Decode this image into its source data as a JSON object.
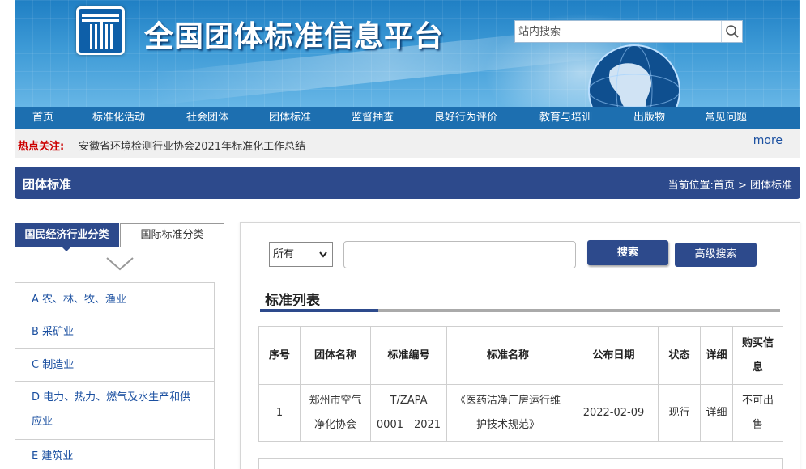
{
  "header": {
    "site_title": "全国团体标准信息平台",
    "search_placeholder": "站内搜索"
  },
  "nav": {
    "items": [
      "首页",
      "标准化活动",
      "社会团体",
      "团体标准",
      "监督抽查",
      "良好行为评价",
      "教育与培训",
      "出版物",
      "常见问题"
    ]
  },
  "hotbar": {
    "label": "热点关注:",
    "text": "安徽省环境检测行业协会2021年标准化工作总结",
    "more": "more"
  },
  "section": {
    "title": "团体标准",
    "breadcrumb": "当前位置:首页 > 团体标准"
  },
  "left": {
    "tab_active": "国民经济行业分类",
    "tab_other": "国际标准分类",
    "categories": [
      "A 农、林、牧、渔业",
      "B 采矿业",
      "C 制造业",
      "D 电力、热力、燃气及水生产和供应业",
      "E 建筑业"
    ]
  },
  "search": {
    "select_value": "所有",
    "keyword_value": "",
    "search_label": "搜索",
    "advanced_label": "高级搜索"
  },
  "list": {
    "title": "标准列表",
    "columns": [
      "序号",
      "团体名称",
      "标准编号",
      "标准名称",
      "公布日期",
      "状态",
      "详细",
      "购买信息"
    ],
    "rows": [
      {
        "no": "1",
        "org": "郑州市空气净化协会",
        "code": "T/ZAPA 0001—2021",
        "name": "《医药洁净厂房运行维护技术规范》",
        "date": "2022-02-09",
        "status": "现行",
        "detail": "详细",
        "purchase": "不可出售"
      }
    ]
  },
  "colors": {
    "brand_blue": "#2d4a8c",
    "nav_blue": "#1d6fb0",
    "link_blue": "#1a4fa0",
    "hot_red": "#cc0000"
  },
  "icons": [
    "logo-icon",
    "search-icon",
    "chevron-down-icon",
    "globe-icon"
  ]
}
